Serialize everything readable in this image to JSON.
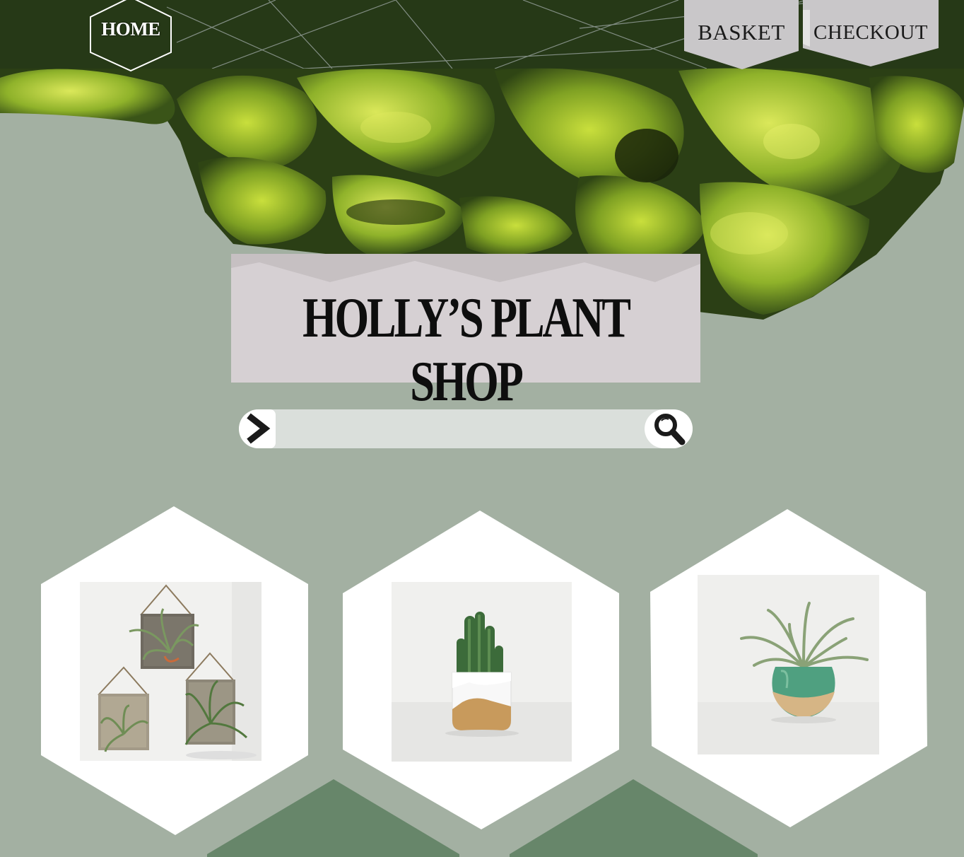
{
  "nav": {
    "home_label": "HOME",
    "basket_label": "BASKET",
    "checkout_label": "CHECKOUT"
  },
  "hero": {
    "title": "HOLLY’S PLANT SHOP"
  },
  "search": {
    "value": "",
    "go_icon": "chevron-right-icon",
    "search_icon": "magnifier-icon"
  },
  "products": [
    {
      "image": "hanging air plants on wooden boards"
    },
    {
      "image": "cactus in white and wood pot"
    },
    {
      "image": "air plant in teal and wood globe pot"
    }
  ],
  "colors": {
    "background": "#a3b0a2",
    "title_box": "#d6d0d3",
    "accent_dark_green": "#67866a",
    "moss": "#9fbf2e"
  }
}
